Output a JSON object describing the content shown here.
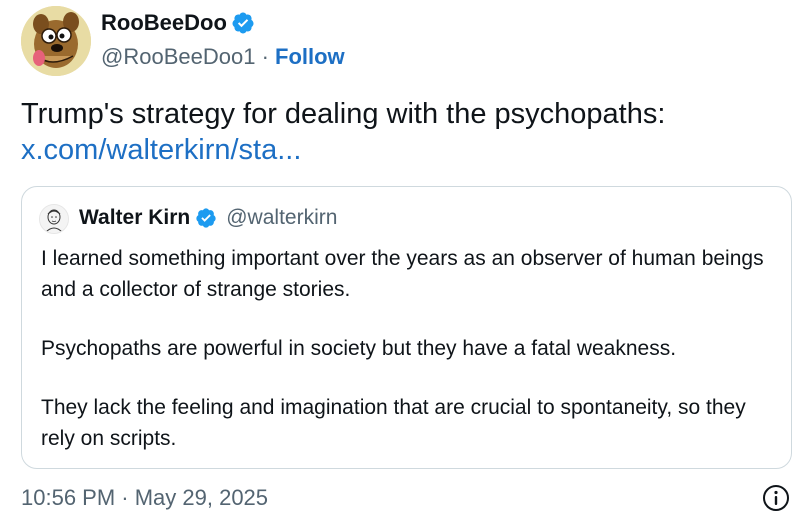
{
  "author": {
    "display_name": "RooBeeDoo",
    "handle": "@RooBeeDoo1",
    "separator": "·",
    "follow_label": "Follow"
  },
  "tweet": {
    "text": "Trump's strategy for dealing with the psychopaths:",
    "link_text": "x.com/walterkirn/sta..."
  },
  "quote": {
    "display_name": "Walter Kirn",
    "handle": "@walterkirn",
    "paragraphs": [
      "I learned something important over the years as an observer of human beings and a collector of strange stories.",
      "Psychopaths are powerful in society but they have a fatal weakness.",
      "They lack the feeling and imagination that are crucial to spontaneity, so they rely on scripts."
    ]
  },
  "timestamp": "10:56 PM · May 29, 2025",
  "icons": {
    "verified": "verified-badge-icon",
    "info": "info-icon"
  },
  "colors": {
    "link": "#1d6fc4",
    "verified": "#1d9bf0",
    "muted": "#536471",
    "border": "#cfd9de"
  }
}
